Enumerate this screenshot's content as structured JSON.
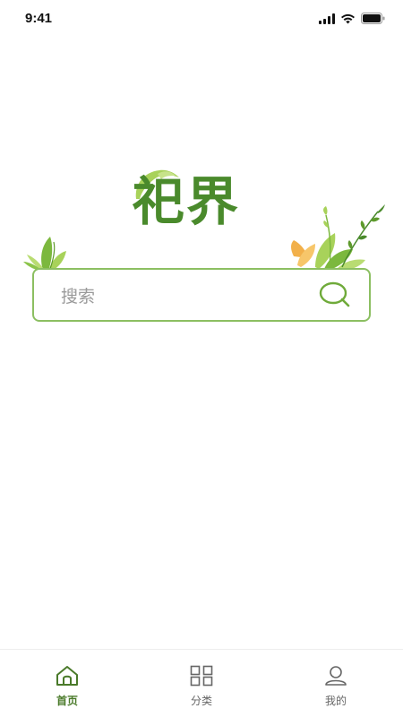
{
  "status_bar": {
    "time": "9:41",
    "icons": [
      "signal-icon",
      "wifi-icon",
      "battery-icon"
    ]
  },
  "logo": {
    "text": "祀界",
    "color": "#4a8a2c"
  },
  "search": {
    "placeholder": "搜索",
    "icon": "search-icon",
    "border_color": "#8cbf62"
  },
  "tab_bar": {
    "active_color": "#4a7a2a",
    "items": [
      {
        "label": "首页",
        "icon": "home-icon",
        "active": true
      },
      {
        "label": "分类",
        "icon": "grid-icon",
        "active": false
      },
      {
        "label": "我的",
        "icon": "user-icon",
        "active": false
      }
    ]
  }
}
